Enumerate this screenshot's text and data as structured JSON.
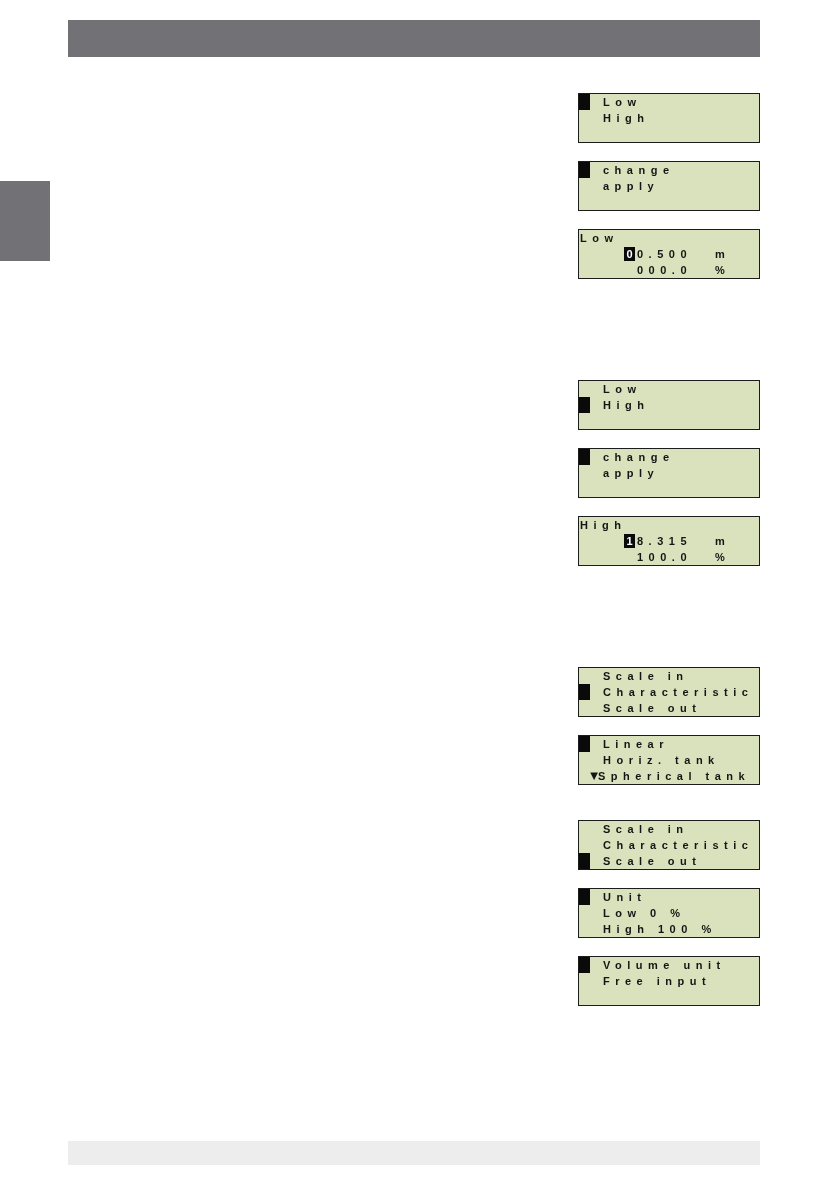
{
  "sections": [
    {
      "displays": [
        {
          "kind": "menu",
          "items": [
            {
              "label": "Low",
              "selected": true
            },
            {
              "label": "High",
              "selected": false
            }
          ]
        },
        {
          "kind": "menu",
          "items": [
            {
              "label": "change",
              "selected": true
            },
            {
              "label": "apply",
              "selected": false
            }
          ]
        },
        {
          "kind": "edit",
          "title": "Low",
          "rows": [
            {
              "cursor": "0",
              "value": "0.500",
              "unit": "m"
            },
            {
              "value": "000.0",
              "unit": "%"
            }
          ]
        }
      ]
    },
    {
      "displays": [
        {
          "kind": "menu",
          "items": [
            {
              "label": "Low",
              "selected": false
            },
            {
              "label": "High",
              "selected": true
            }
          ]
        },
        {
          "kind": "menu",
          "items": [
            {
              "label": "change",
              "selected": true
            },
            {
              "label": "apply",
              "selected": false
            }
          ]
        },
        {
          "kind": "edit",
          "title": "High",
          "rows": [
            {
              "cursor": "1",
              "value": "8.315",
              "unit": "m"
            },
            {
              "value": "100.0",
              "unit": "%"
            }
          ]
        }
      ]
    },
    {
      "displays": [
        {
          "kind": "menu",
          "items": [
            {
              "label": "Scale in",
              "selected": false
            },
            {
              "label": "Characteristic",
              "selected": true
            },
            {
              "label": "Scale out",
              "selected": false
            }
          ]
        },
        {
          "kind": "menu",
          "items": [
            {
              "label": "Linear",
              "selected": true
            },
            {
              "label": "Horiz. tank",
              "selected": false
            },
            {
              "label": "Spherical tank",
              "selected": false,
              "scroll_mark": "▼"
            }
          ]
        }
      ]
    },
    {
      "displays": [
        {
          "kind": "menu",
          "items": [
            {
              "label": "Scale in",
              "selected": false
            },
            {
              "label": "Characteristic",
              "selected": false
            },
            {
              "label": "Scale out",
              "selected": true
            }
          ]
        },
        {
          "kind": "menu",
          "items": [
            {
              "label": "Unit",
              "selected": true
            },
            {
              "label": "Low 0 %",
              "selected": false
            },
            {
              "label": "High 100 %",
              "selected": false
            }
          ]
        },
        {
          "kind": "menu",
          "items": [
            {
              "label": "Volume unit",
              "selected": true
            },
            {
              "label": "Free input",
              "selected": false
            }
          ]
        }
      ]
    }
  ]
}
